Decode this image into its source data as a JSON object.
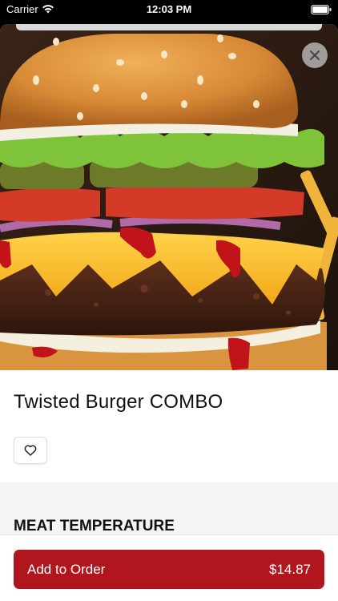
{
  "status_bar": {
    "carrier": "Carrier",
    "time": "12:03 PM"
  },
  "product": {
    "title": "Twisted Burger COMBO",
    "image": "burger-photo"
  },
  "sections": {
    "meat_temperature": "MEAT TEMPERATURE"
  },
  "order_button": {
    "label": "Add to Order",
    "price": "$14.87"
  },
  "colors": {
    "accent": "#b1161f",
    "background": "#ffffff",
    "section_bg": "#f4f4f4"
  },
  "icons": {
    "close": "close-icon",
    "favorite": "heart-icon",
    "wifi": "wifi-icon",
    "battery": "battery-icon"
  }
}
